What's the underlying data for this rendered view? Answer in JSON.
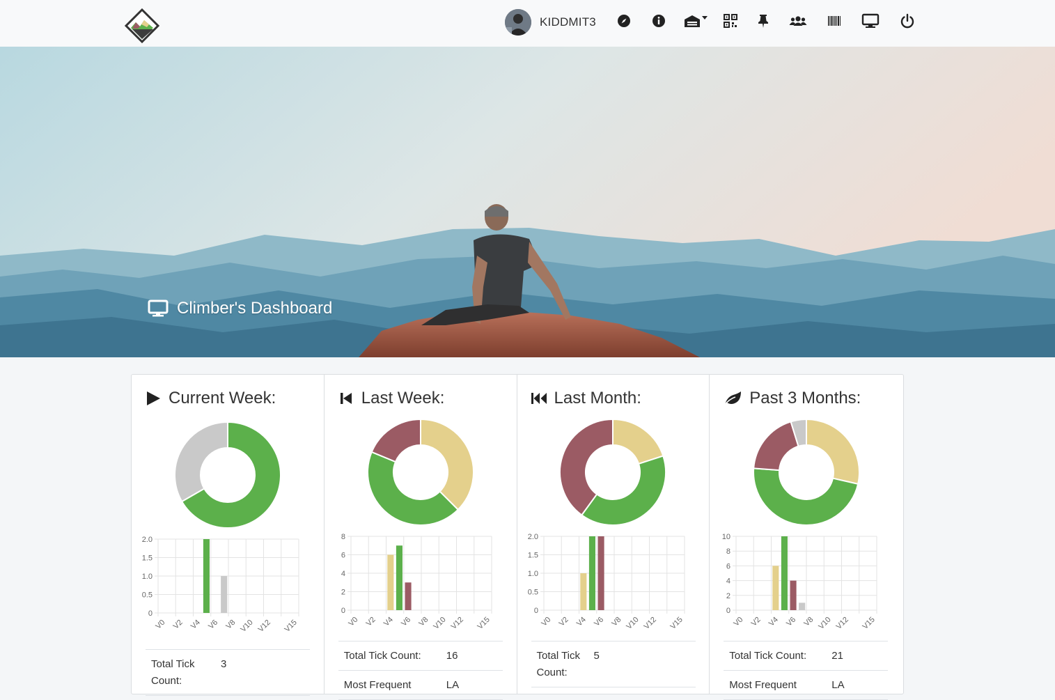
{
  "navbar": {
    "username": "KIDDMIT3",
    "icons": [
      "compass-icon",
      "info-icon",
      "gym-dropdown-icon",
      "qr-code-icon",
      "pin-icon",
      "users-icon",
      "barcode-icon",
      "monitor-icon",
      "power-icon"
    ]
  },
  "hero": {
    "title": "Climber's Dashboard",
    "icon": "monitor-icon"
  },
  "colors": {
    "green": "#5cb04b",
    "yellow": "#e4d08c",
    "maroon": "#9b5b64",
    "gray": "#c9c9c9"
  },
  "cards": [
    {
      "title": "Current Week:",
      "icon": "play-icon",
      "stats": [
        {
          "label": "Total Tick Count:",
          "value": "3"
        }
      ]
    },
    {
      "title": "Last Week:",
      "icon": "step-backward-icon",
      "stats": [
        {
          "label": "Total Tick Count:",
          "value": "16"
        },
        {
          "label": "Most Frequent",
          "value": "LA"
        }
      ]
    },
    {
      "title": "Last Month:",
      "icon": "fast-backward-icon",
      "stats": [
        {
          "label": "Total Tick Count:",
          "value": "5"
        }
      ]
    },
    {
      "title": "Past 3 Months:",
      "icon": "leaf-icon",
      "stats": [
        {
          "label": "Total Tick Count:",
          "value": "21"
        },
        {
          "label": "Most Frequent",
          "value": "LA"
        }
      ]
    }
  ],
  "chart_data": [
    {
      "type": "pie",
      "chart": "current-week-donut",
      "slices": [
        {
          "color": "green",
          "value": 2
        },
        {
          "color": "gray",
          "value": 1
        }
      ]
    },
    {
      "type": "bar",
      "chart": "current-week-bars",
      "categories": [
        "V0",
        "V2",
        "V4",
        "V6",
        "V8",
        "V10",
        "V12",
        "V15"
      ],
      "ylim": [
        0,
        2
      ],
      "yticks": [
        "0",
        "0.5",
        "1.0",
        "1.5",
        "2.0"
      ],
      "series": [
        {
          "grade": "V5",
          "value": 2,
          "color": "green"
        },
        {
          "grade": "V7",
          "value": 1,
          "color": "gray"
        }
      ]
    },
    {
      "type": "pie",
      "chart": "last-week-donut",
      "slices": [
        {
          "color": "yellow",
          "value": 6
        },
        {
          "color": "green",
          "value": 7
        },
        {
          "color": "maroon",
          "value": 3
        }
      ]
    },
    {
      "type": "bar",
      "chart": "last-week-bars",
      "categories": [
        "V0",
        "V2",
        "V4",
        "V6",
        "V8",
        "V10",
        "V12",
        "V15"
      ],
      "ylim": [
        0,
        8
      ],
      "yticks": [
        "0",
        "2",
        "4",
        "6",
        "8"
      ],
      "series": [
        {
          "grade": "V4",
          "value": 6,
          "color": "yellow"
        },
        {
          "grade": "V5",
          "value": 7,
          "color": "green"
        },
        {
          "grade": "V6",
          "value": 3,
          "color": "maroon"
        }
      ]
    },
    {
      "type": "pie",
      "chart": "last-month-donut",
      "slices": [
        {
          "color": "yellow",
          "value": 1
        },
        {
          "color": "green",
          "value": 2
        },
        {
          "color": "maroon",
          "value": 2
        }
      ]
    },
    {
      "type": "bar",
      "chart": "last-month-bars",
      "categories": [
        "V0",
        "V2",
        "V4",
        "V6",
        "V8",
        "V10",
        "V12",
        "V15"
      ],
      "ylim": [
        0,
        2
      ],
      "yticks": [
        "0",
        "0.5",
        "1.0",
        "1.5",
        "2.0"
      ],
      "series": [
        {
          "grade": "V4",
          "value": 1,
          "color": "yellow"
        },
        {
          "grade": "V5",
          "value": 2,
          "color": "green"
        },
        {
          "grade": "V6",
          "value": 2,
          "color": "maroon"
        }
      ]
    },
    {
      "type": "pie",
      "chart": "past-3-months-donut",
      "slices": [
        {
          "color": "yellow",
          "value": 6
        },
        {
          "color": "green",
          "value": 10
        },
        {
          "color": "maroon",
          "value": 4
        },
        {
          "color": "gray",
          "value": 1
        }
      ]
    },
    {
      "type": "bar",
      "chart": "past-3-months-bars",
      "categories": [
        "V0",
        "V2",
        "V4",
        "V6",
        "V8",
        "V10",
        "V12",
        "V15"
      ],
      "ylim": [
        0,
        10
      ],
      "yticks": [
        "0",
        "2",
        "4",
        "6",
        "8",
        "10"
      ],
      "series": [
        {
          "grade": "V4",
          "value": 6,
          "color": "yellow"
        },
        {
          "grade": "V5",
          "value": 10,
          "color": "green"
        },
        {
          "grade": "V6",
          "value": 4,
          "color": "maroon"
        },
        {
          "grade": "V7",
          "value": 1,
          "color": "gray"
        }
      ]
    }
  ]
}
